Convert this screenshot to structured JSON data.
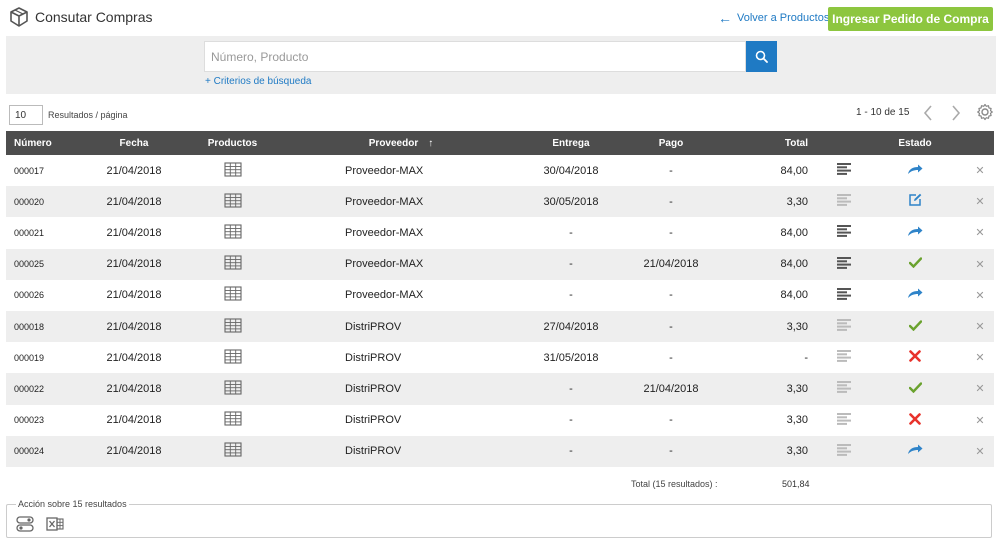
{
  "header": {
    "title": "Consutar Compras",
    "back_link": "Volver a Productos",
    "primary_button": "Ingresar Pedido de Compra"
  },
  "search": {
    "placeholder": "Número, Producto",
    "value": "",
    "criteria_link": "+ Criterios de búsqueda"
  },
  "pager": {
    "per_page": "10",
    "per_page_label": "Resultados / página",
    "range": "1 - 10 de 15"
  },
  "table": {
    "headers": {
      "numero": "Número",
      "fecha": "Fecha",
      "productos": "Productos",
      "proveedor": "Proveedor",
      "entrega": "Entrega",
      "pago": "Pago",
      "total": "Total",
      "estado": "Estado"
    },
    "rows": [
      {
        "numero": "000017",
        "fecha": "21/04/2018",
        "proveedor": "Proveedor-MAX",
        "entrega": "30/04/2018",
        "pago": "-",
        "total": "84,00",
        "detail_active": true,
        "estado": "sent-icon"
      },
      {
        "numero": "000020",
        "fecha": "21/04/2018",
        "proveedor": "Proveedor-MAX",
        "entrega": "30/05/2018",
        "pago": "-",
        "total": "3,30",
        "detail_active": false,
        "estado": "edit-icon"
      },
      {
        "numero": "000021",
        "fecha": "21/04/2018",
        "proveedor": "Proveedor-MAX",
        "entrega": "-",
        "pago": "-",
        "total": "84,00",
        "detail_active": true,
        "estado": "sent-icon"
      },
      {
        "numero": "000025",
        "fecha": "21/04/2018",
        "proveedor": "Proveedor-MAX",
        "entrega": "-",
        "pago": "21/04/2018",
        "total": "84,00",
        "detail_active": true,
        "estado": "check-icon"
      },
      {
        "numero": "000026",
        "fecha": "21/04/2018",
        "proveedor": "Proveedor-MAX",
        "entrega": "-",
        "pago": "-",
        "total": "84,00",
        "detail_active": true,
        "estado": "sent-icon"
      },
      {
        "numero": "000018",
        "fecha": "21/04/2018",
        "proveedor": "DistriPROV",
        "entrega": "27/04/2018",
        "pago": "-",
        "total": "3,30",
        "detail_active": false,
        "estado": "check-icon"
      },
      {
        "numero": "000019",
        "fecha": "21/04/2018",
        "proveedor": "DistriPROV",
        "entrega": "31/05/2018",
        "pago": "-",
        "total": "-",
        "detail_active": false,
        "estado": "cancel-icon"
      },
      {
        "numero": "000022",
        "fecha": "21/04/2018",
        "proveedor": "DistriPROV",
        "entrega": "-",
        "pago": "21/04/2018",
        "total": "3,30",
        "detail_active": false,
        "estado": "check-icon"
      },
      {
        "numero": "000023",
        "fecha": "21/04/2018",
        "proveedor": "DistriPROV",
        "entrega": "-",
        "pago": "-",
        "total": "3,30",
        "detail_active": false,
        "estado": "cancel-icon"
      },
      {
        "numero": "000024",
        "fecha": "21/04/2018",
        "proveedor": "DistriPROV",
        "entrega": "-",
        "pago": "-",
        "total": "3,30",
        "detail_active": false,
        "estado": "sent-icon"
      }
    ],
    "total_label": "Total (15 resultados) :",
    "total_value": "501,84"
  },
  "actions": {
    "legend": "Acción sobre 15 resultados"
  },
  "colors": {
    "accent": "#1f7ac4",
    "primary_button": "#8dc63f",
    "table_header": "#4d4d4d",
    "check": "#6aa22e",
    "cancel": "#e8322b"
  }
}
